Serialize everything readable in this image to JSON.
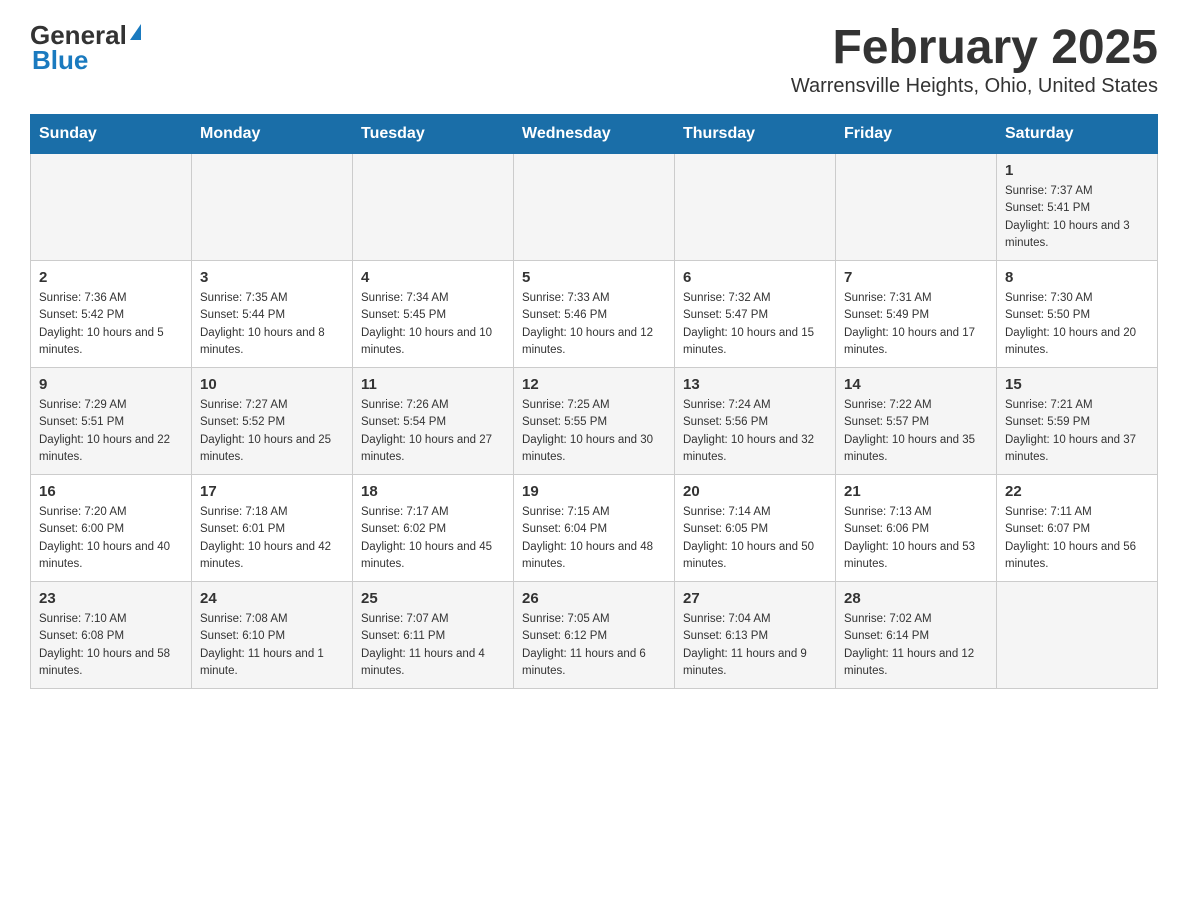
{
  "header": {
    "logo_general": "General",
    "logo_blue": "Blue",
    "month_title": "February 2025",
    "location": "Warrensville Heights, Ohio, United States"
  },
  "days_of_week": [
    "Sunday",
    "Monday",
    "Tuesday",
    "Wednesday",
    "Thursday",
    "Friday",
    "Saturday"
  ],
  "weeks": [
    [
      {
        "day": "",
        "info": ""
      },
      {
        "day": "",
        "info": ""
      },
      {
        "day": "",
        "info": ""
      },
      {
        "day": "",
        "info": ""
      },
      {
        "day": "",
        "info": ""
      },
      {
        "day": "",
        "info": ""
      },
      {
        "day": "1",
        "info": "Sunrise: 7:37 AM\nSunset: 5:41 PM\nDaylight: 10 hours and 3 minutes."
      }
    ],
    [
      {
        "day": "2",
        "info": "Sunrise: 7:36 AM\nSunset: 5:42 PM\nDaylight: 10 hours and 5 minutes."
      },
      {
        "day": "3",
        "info": "Sunrise: 7:35 AM\nSunset: 5:44 PM\nDaylight: 10 hours and 8 minutes."
      },
      {
        "day": "4",
        "info": "Sunrise: 7:34 AM\nSunset: 5:45 PM\nDaylight: 10 hours and 10 minutes."
      },
      {
        "day": "5",
        "info": "Sunrise: 7:33 AM\nSunset: 5:46 PM\nDaylight: 10 hours and 12 minutes."
      },
      {
        "day": "6",
        "info": "Sunrise: 7:32 AM\nSunset: 5:47 PM\nDaylight: 10 hours and 15 minutes."
      },
      {
        "day": "7",
        "info": "Sunrise: 7:31 AM\nSunset: 5:49 PM\nDaylight: 10 hours and 17 minutes."
      },
      {
        "day": "8",
        "info": "Sunrise: 7:30 AM\nSunset: 5:50 PM\nDaylight: 10 hours and 20 minutes."
      }
    ],
    [
      {
        "day": "9",
        "info": "Sunrise: 7:29 AM\nSunset: 5:51 PM\nDaylight: 10 hours and 22 minutes."
      },
      {
        "day": "10",
        "info": "Sunrise: 7:27 AM\nSunset: 5:52 PM\nDaylight: 10 hours and 25 minutes."
      },
      {
        "day": "11",
        "info": "Sunrise: 7:26 AM\nSunset: 5:54 PM\nDaylight: 10 hours and 27 minutes."
      },
      {
        "day": "12",
        "info": "Sunrise: 7:25 AM\nSunset: 5:55 PM\nDaylight: 10 hours and 30 minutes."
      },
      {
        "day": "13",
        "info": "Sunrise: 7:24 AM\nSunset: 5:56 PM\nDaylight: 10 hours and 32 minutes."
      },
      {
        "day": "14",
        "info": "Sunrise: 7:22 AM\nSunset: 5:57 PM\nDaylight: 10 hours and 35 minutes."
      },
      {
        "day": "15",
        "info": "Sunrise: 7:21 AM\nSunset: 5:59 PM\nDaylight: 10 hours and 37 minutes."
      }
    ],
    [
      {
        "day": "16",
        "info": "Sunrise: 7:20 AM\nSunset: 6:00 PM\nDaylight: 10 hours and 40 minutes."
      },
      {
        "day": "17",
        "info": "Sunrise: 7:18 AM\nSunset: 6:01 PM\nDaylight: 10 hours and 42 minutes."
      },
      {
        "day": "18",
        "info": "Sunrise: 7:17 AM\nSunset: 6:02 PM\nDaylight: 10 hours and 45 minutes."
      },
      {
        "day": "19",
        "info": "Sunrise: 7:15 AM\nSunset: 6:04 PM\nDaylight: 10 hours and 48 minutes."
      },
      {
        "day": "20",
        "info": "Sunrise: 7:14 AM\nSunset: 6:05 PM\nDaylight: 10 hours and 50 minutes."
      },
      {
        "day": "21",
        "info": "Sunrise: 7:13 AM\nSunset: 6:06 PM\nDaylight: 10 hours and 53 minutes."
      },
      {
        "day": "22",
        "info": "Sunrise: 7:11 AM\nSunset: 6:07 PM\nDaylight: 10 hours and 56 minutes."
      }
    ],
    [
      {
        "day": "23",
        "info": "Sunrise: 7:10 AM\nSunset: 6:08 PM\nDaylight: 10 hours and 58 minutes."
      },
      {
        "day": "24",
        "info": "Sunrise: 7:08 AM\nSunset: 6:10 PM\nDaylight: 11 hours and 1 minute."
      },
      {
        "day": "25",
        "info": "Sunrise: 7:07 AM\nSunset: 6:11 PM\nDaylight: 11 hours and 4 minutes."
      },
      {
        "day": "26",
        "info": "Sunrise: 7:05 AM\nSunset: 6:12 PM\nDaylight: 11 hours and 6 minutes."
      },
      {
        "day": "27",
        "info": "Sunrise: 7:04 AM\nSunset: 6:13 PM\nDaylight: 11 hours and 9 minutes."
      },
      {
        "day": "28",
        "info": "Sunrise: 7:02 AM\nSunset: 6:14 PM\nDaylight: 11 hours and 12 minutes."
      },
      {
        "day": "",
        "info": ""
      }
    ]
  ]
}
